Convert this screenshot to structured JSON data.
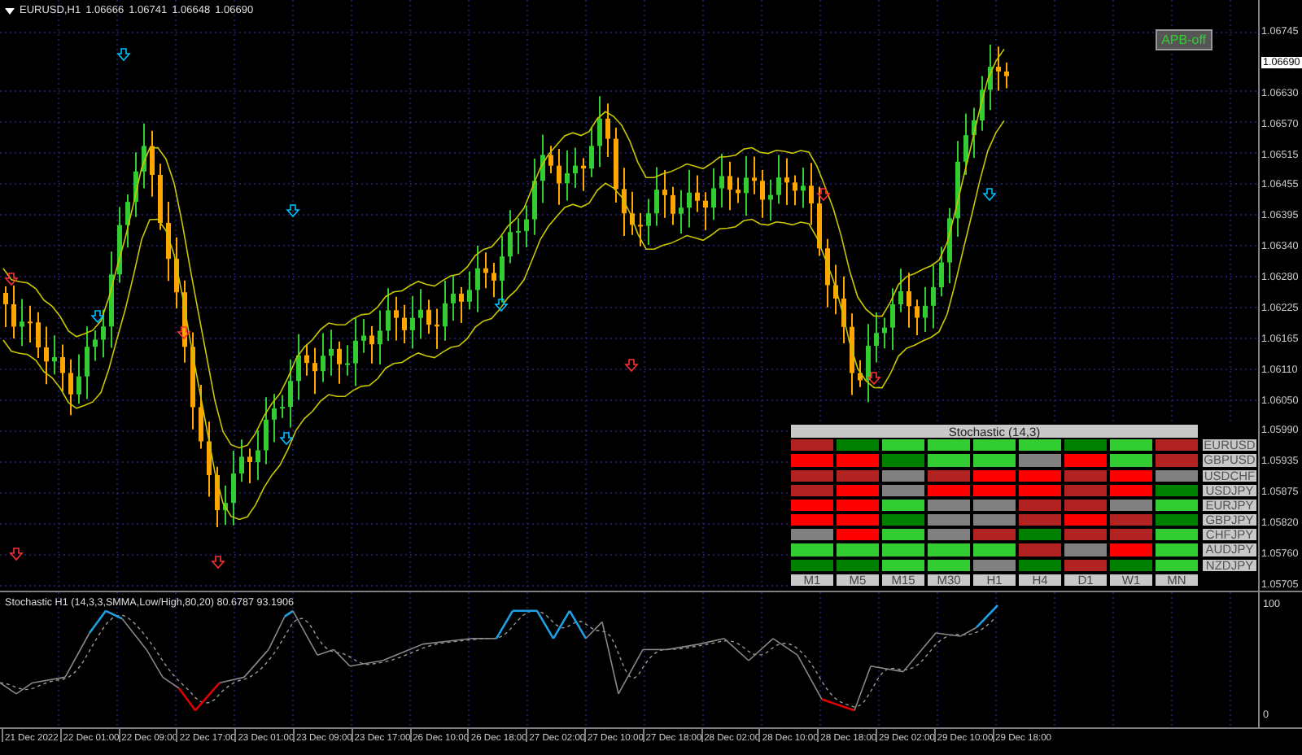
{
  "chart": {
    "symbol": "EURUSD,H1",
    "ohlc": [
      "1.06666",
      "1.06741",
      "1.06648",
      "1.06690"
    ],
    "apb_button": "APB-off",
    "current_price": "1.06690",
    "price_axis": [
      "1.06745",
      "1.06630",
      "1.06570",
      "1.06515",
      "1.06455",
      "1.06395",
      "1.06340",
      "1.06280",
      "1.06225",
      "1.06165",
      "1.06110",
      "1.06050",
      "1.05990",
      "1.05935",
      "1.05875",
      "1.05820",
      "1.05760",
      "1.05705"
    ]
  },
  "stochastic_table": {
    "title": "Stochastic (14,3)",
    "timeframes": [
      "M1",
      "M5",
      "M15",
      "M30",
      "H1",
      "H4",
      "D1",
      "W1",
      "MN"
    ],
    "rows": [
      {
        "pair": "EURUSD",
        "cells": [
          {
            "color": "#b22222"
          },
          {
            "color": "#008000"
          },
          {
            "color": "#32cd32"
          },
          {
            "color": "#32cd32"
          },
          {
            "color": "#32cd32"
          },
          {
            "color": "#32cd32"
          },
          {
            "color": "#008000"
          },
          {
            "color": "#32cd32"
          },
          {
            "color": "#b22222"
          }
        ]
      },
      {
        "pair": "GBPUSD",
        "cells": [
          {
            "color": "#ff0000"
          },
          {
            "color": "#ff0000"
          },
          {
            "color": "#008000"
          },
          {
            "color": "#32cd32"
          },
          {
            "color": "#32cd32"
          },
          {
            "color": "#808080"
          },
          {
            "color": "#ff0000"
          },
          {
            "color": "#32cd32"
          },
          {
            "color": "#b22222"
          }
        ]
      },
      {
        "pair": "USDCHF",
        "cells": [
          {
            "color": "#b22222"
          },
          {
            "color": "#b22222"
          },
          {
            "color": "#808080"
          },
          {
            "color": "#b22222"
          },
          {
            "color": "#ff0000"
          },
          {
            "color": "#ff0000"
          },
          {
            "color": "#b22222"
          },
          {
            "color": "#ff0000"
          },
          {
            "color": "#808080"
          }
        ]
      },
      {
        "pair": "USDJPY",
        "cells": [
          {
            "color": "#b22222"
          },
          {
            "color": "#ff0000"
          },
          {
            "color": "#808080"
          },
          {
            "color": "#ff0000"
          },
          {
            "color": "#ff0000"
          },
          {
            "color": "#ff0000"
          },
          {
            "color": "#b22222"
          },
          {
            "color": "#ff0000"
          },
          {
            "color": "#008000"
          }
        ]
      },
      {
        "pair": "EURJPY",
        "cells": [
          {
            "color": "#ff0000"
          },
          {
            "color": "#ff0000"
          },
          {
            "color": "#32cd32"
          },
          {
            "color": "#808080"
          },
          {
            "color": "#808080"
          },
          {
            "color": "#b22222"
          },
          {
            "color": "#b22222"
          },
          {
            "color": "#808080"
          },
          {
            "color": "#32cd32"
          }
        ]
      },
      {
        "pair": "GBPJPY",
        "cells": [
          {
            "color": "#ff0000"
          },
          {
            "color": "#ff0000"
          },
          {
            "color": "#008000"
          },
          {
            "color": "#808080"
          },
          {
            "color": "#808080"
          },
          {
            "color": "#b22222"
          },
          {
            "color": "#ff0000"
          },
          {
            "color": "#b22222"
          },
          {
            "color": "#008000"
          }
        ]
      },
      {
        "pair": "CHFJPY",
        "cells": [
          {
            "color": "#808080"
          },
          {
            "color": "#ff0000"
          },
          {
            "color": "#32cd32"
          },
          {
            "color": "#808080"
          },
          {
            "color": "#b22222"
          },
          {
            "color": "#008000"
          },
          {
            "color": "#b22222"
          },
          {
            "color": "#b22222"
          },
          {
            "color": "#32cd32"
          }
        ]
      },
      {
        "pair": "AUDJPY",
        "cells": [
          {
            "color": "#32cd32"
          },
          {
            "color": "#32cd32"
          },
          {
            "color": "#32cd32"
          },
          {
            "color": "#32cd32"
          },
          {
            "color": "#32cd32"
          },
          {
            "color": "#b22222"
          },
          {
            "color": "#808080"
          },
          {
            "color": "#ff0000"
          },
          {
            "color": "#32cd32"
          }
        ]
      },
      {
        "pair": "NZDJPY",
        "cells": [
          {
            "color": "#008000"
          },
          {
            "color": "#008000"
          },
          {
            "color": "#32cd32"
          },
          {
            "color": "#32cd32"
          },
          {
            "color": "#808080"
          },
          {
            "color": "#008000"
          },
          {
            "color": "#b22222"
          },
          {
            "color": "#008000"
          },
          {
            "color": "#32cd32"
          }
        ]
      }
    ]
  },
  "indicator": {
    "title": "Stochastic H1 (14,3,3,SMMA,Low/High,80,20) 80.6787 93.1906",
    "scale": [
      "100",
      "0"
    ]
  },
  "time_axis": [
    "21 Dec 2022",
    "22 Dec 01:00",
    "22 Dec 09:00",
    "22 Dec 17:00",
    "23 Dec 01:00",
    "23 Dec 09:00",
    "23 Dec 17:00",
    "26 Dec 10:00",
    "26 Dec 18:00",
    "27 Dec 02:00",
    "27 Dec 10:00",
    "27 Dec 18:00",
    "28 Dec 02:00",
    "28 Dec 10:00",
    "28 Dec 18:00",
    "29 Dec 02:00",
    "29 Dec 10:00",
    "29 Dec 18:00"
  ]
}
